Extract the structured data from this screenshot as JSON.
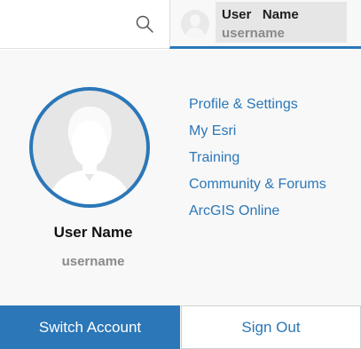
{
  "header": {
    "search_icon": "search-icon",
    "user_trigger": {
      "name": "User   Name",
      "username": "username"
    }
  },
  "profile": {
    "avatar_icon": "user-silhouette-icon",
    "name": "User Name",
    "username": "username"
  },
  "links": [
    "Profile & Settings",
    "My Esri",
    "Training",
    "Community & Forums",
    "ArcGIS Online"
  ],
  "buttons": {
    "switch_account": "Switch Account",
    "sign_out": "Sign Out"
  },
  "colors": {
    "accent": "#2b77b8",
    "panel_bg": "#f8f8f8"
  }
}
